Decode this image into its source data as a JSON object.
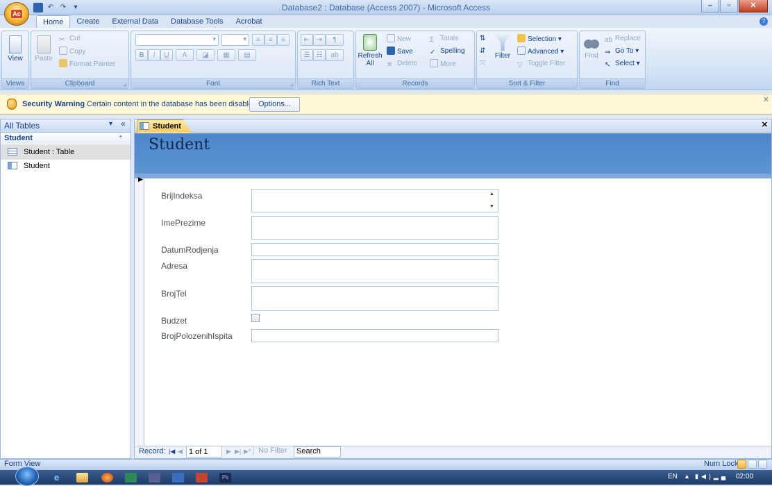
{
  "window": {
    "title": "Database2 : Database (Access 2007) - Microsoft Access"
  },
  "office_button": {
    "logo_text": "Ac"
  },
  "quick_access": [
    "save-icon",
    "undo-icon",
    "redo-icon",
    "customize-icon"
  ],
  "ribbon": {
    "tabs": [
      "Home",
      "Create",
      "External Data",
      "Database Tools",
      "Acrobat"
    ],
    "active_tab": "Home",
    "groups": {
      "views": {
        "label": "Views",
        "view": "View"
      },
      "clipboard": {
        "label": "Clipboard",
        "paste": "Paste",
        "cut": "Cut",
        "copy": "Copy",
        "format_painter": "Format Painter"
      },
      "font": {
        "label": "Font",
        "bold": "B",
        "italic": "I",
        "underline": "U"
      },
      "rich_text": {
        "label": "Rich Text"
      },
      "records": {
        "label": "Records",
        "refresh": "Refresh",
        "refresh_sub": "All",
        "new": "New",
        "save": "Save",
        "delete": "Delete",
        "totals": "Totals",
        "spelling": "Spelling",
        "more": "More"
      },
      "sort_filter": {
        "label": "Sort & Filter",
        "filter": "Filter",
        "selection": "Selection",
        "advanced": "Advanced",
        "toggle_filter": "Toggle Filter"
      },
      "find": {
        "label": "Find",
        "find": "Find",
        "replace": "Replace",
        "goto": "Go To",
        "select": "Select"
      }
    }
  },
  "security_bar": {
    "title": "Security Warning",
    "message": "Certain content in the database has been disabled",
    "options": "Options..."
  },
  "nav_pane": {
    "header": "All Tables",
    "group": "Student",
    "items": [
      {
        "label": "Student : Table",
        "icon": "table-icon"
      },
      {
        "label": "Student",
        "icon": "form-icon"
      }
    ]
  },
  "document": {
    "tab": "Student",
    "form_title": "Student",
    "fields": [
      {
        "label": "BrijIndeksa",
        "value": ""
      },
      {
        "label": "ImePrezime",
        "value": ""
      },
      {
        "label": "DatumRodjenja",
        "value": ""
      },
      {
        "label": "Adresa",
        "value": ""
      },
      {
        "label": "BrojTel",
        "value": ""
      },
      {
        "label": "Budzet",
        "checked": false
      },
      {
        "label": "BrojPolozenihIspita",
        "value": ""
      }
    ]
  },
  "record_nav": {
    "label": "Record:",
    "position": "1 of 1",
    "filter": "No Filter",
    "search": "Search"
  },
  "status_bar": {
    "left": "Form View",
    "num_lock": "Num Lock"
  },
  "taskbar": {
    "language": "EN",
    "clock": "02:00"
  }
}
